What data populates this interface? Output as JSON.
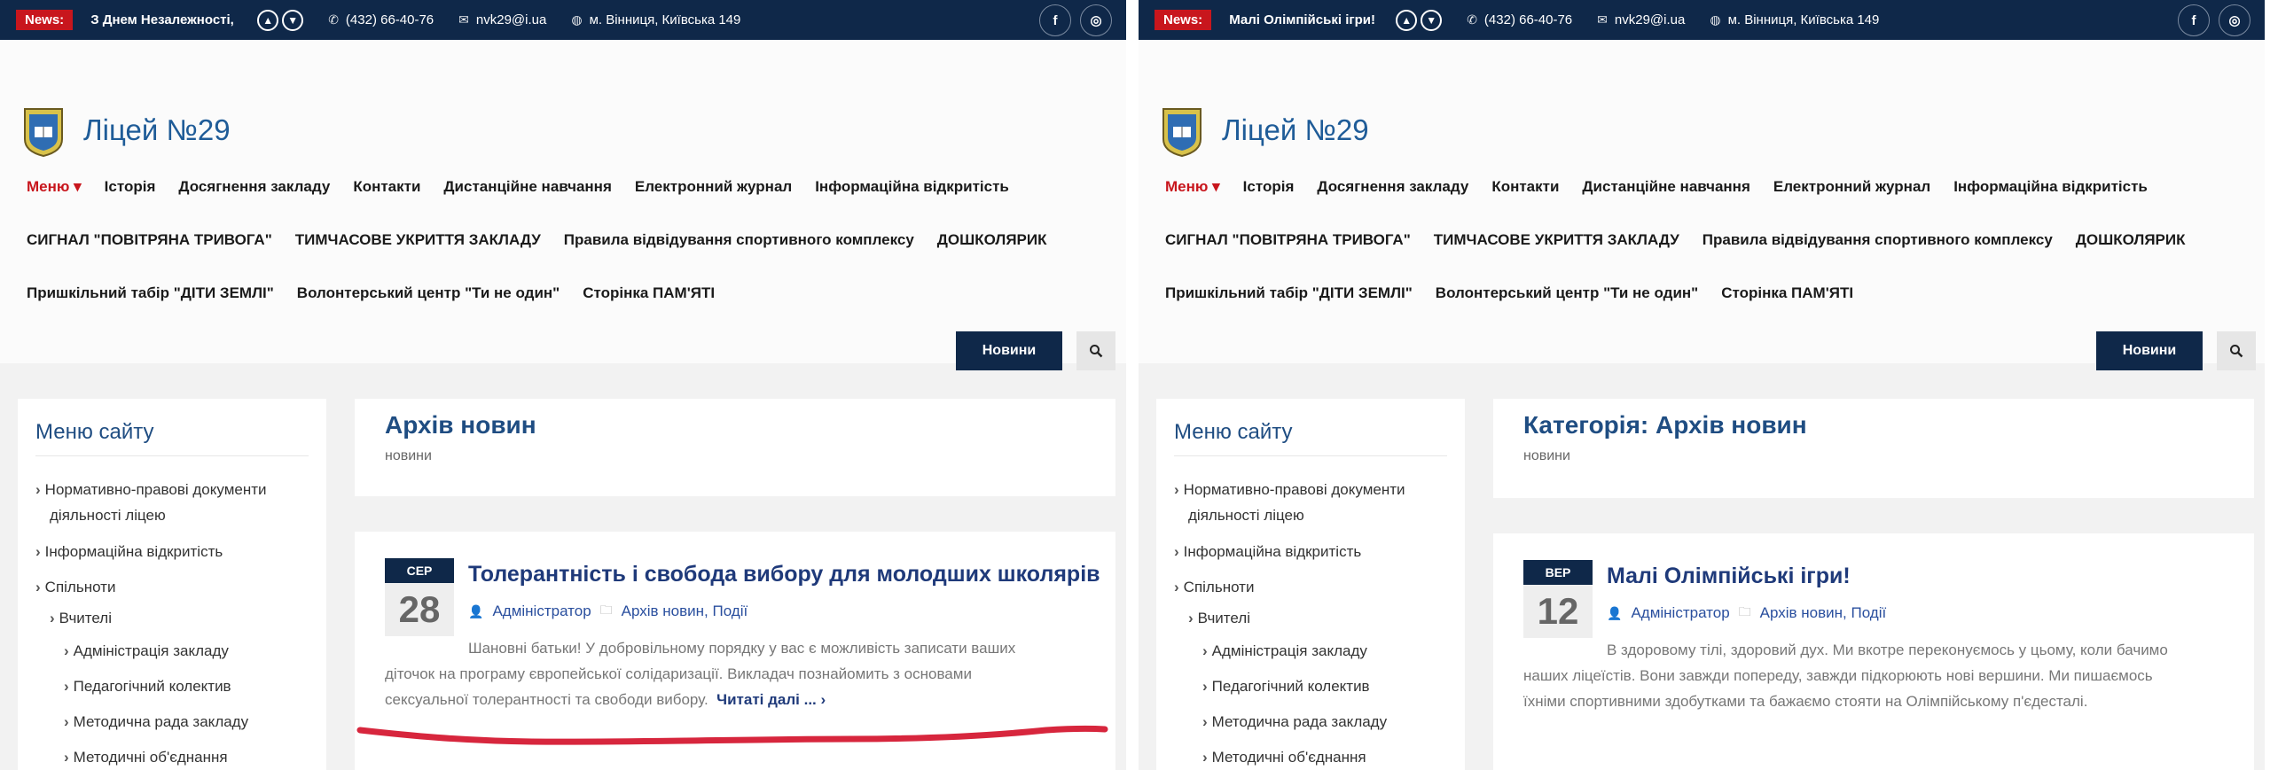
{
  "left": {
    "topbar": {
      "news_label": "News:",
      "ticker": "З Днем Незалежності,",
      "phone": "(432) 66-40-76",
      "email": "nvk29@i.ua",
      "address": "м. Вінниця, Київська 149",
      "social_facebook": "f",
      "social_instagram": "◎"
    },
    "site_title": "Ліцей №29",
    "menu": {
      "row1": [
        "Меню ▾",
        "Історія",
        "Досягнення закладу",
        "Контакти",
        "Дистанційне навчання",
        "Електронний журнал",
        "Інформаційна відкритість"
      ],
      "row2": [
        "СИГНАЛ \"ПОВІТРЯНА ТРИВОГА\"",
        "ТИМЧАСОВЕ УКРИТТЯ ЗАКЛАДУ",
        "Правила відвідування спортивного комплексу",
        "ДОШКОЛЯРИК"
      ],
      "row3": [
        "Пришкільний табір \"ДІТИ ЗЕМЛІ\"",
        "Волонтерський центр \"Ти не один\"",
        "Сторінка ПАМ'ЯТІ"
      ]
    },
    "news_button": "Новини",
    "sidebar": {
      "title": "Меню сайту",
      "items": [
        "Нормативно-правові документи",
        "діяльності ліцею",
        "Інформаційна відкритість",
        "Спільноти",
        "Вчителі",
        "Адміністрація закладу",
        "Педагогічний колектив",
        "Методична рада закладу",
        "Методичні об'єднання"
      ]
    },
    "archive": {
      "title": "Архів новин",
      "subtitle": "новини"
    },
    "post": {
      "month": "СЕР",
      "day": "28",
      "title": "Толерантність і свобода вибору для молодших школярів",
      "author": "Адміністратор",
      "categories": "Архів новин, Події",
      "excerpt_line1": "Шановні батьки! У добровільному порядку у вас є можливість записати ваших",
      "excerpt_line2": "діточок на програму європейської солідаризації. Викладач познайомить з основами",
      "excerpt_line3": "сексуальної толерантності та свободи вибору.",
      "read_more": "Читаті далі ... ›"
    }
  },
  "right": {
    "topbar": {
      "news_label": "News:",
      "ticker": "Малі Олімпійські ігри!",
      "phone": "(432) 66-40-76",
      "email": "nvk29@i.ua",
      "address": "м. Вінниця, Київська 149",
      "social_facebook": "f",
      "social_instagram": "◎"
    },
    "site_title": "Ліцей №29",
    "menu": {
      "row1": [
        "Меню ▾",
        "Історія",
        "Досягнення закладу",
        "Контакти",
        "Дистанційне навчання",
        "Електронний журнал",
        "Інформаційна відкритість"
      ],
      "row2": [
        "СИГНАЛ \"ПОВІТРЯНА ТРИВОГА\"",
        "ТИМЧАСОВЕ УКРИТТЯ ЗАКЛАДУ",
        "Правила відвідування спортивного комплексу",
        "ДОШКОЛЯРИК"
      ],
      "row3": [
        "Пришкільний табір \"ДІТИ ЗЕМЛІ\"",
        "Волонтерський центр \"Ти не один\"",
        "Сторінка ПАМ'ЯТІ"
      ]
    },
    "news_button": "Новини",
    "sidebar": {
      "title": "Меню сайту",
      "items": [
        "Нормативно-правові документи",
        "діяльності ліцею",
        "Інформаційна відкритість",
        "Спільноти",
        "Вчителі",
        "Адміністрація закладу",
        "Педагогічний колектив",
        "Методична рада закладу",
        "Методичні об'єднання"
      ]
    },
    "archive": {
      "title": "Категорія: Архів новин",
      "subtitle": "новини"
    },
    "post": {
      "month": "ВЕР",
      "day": "12",
      "title": "Малі Олімпійські ігри!",
      "author": "Адміністратор",
      "categories": "Архів новин, Події",
      "excerpt_line1": "В здоровому тілі, здоровий дух. Ми вкотре переконуємось у цьому, коли бачимо",
      "excerpt_line2": "наших ліцеїстів. Вони завжди попереду, завжди підкорюють нові вершини. Ми пишаємось",
      "excerpt_line3": "їхніми спортивними здобутками та бажаємо стояти на Олімпійському п'єдесталі."
    }
  },
  "colors": {
    "navy": "#0f2849",
    "red": "#c8161d",
    "title_blue": "#1f5c98",
    "annotation_red": "#d7263d"
  }
}
